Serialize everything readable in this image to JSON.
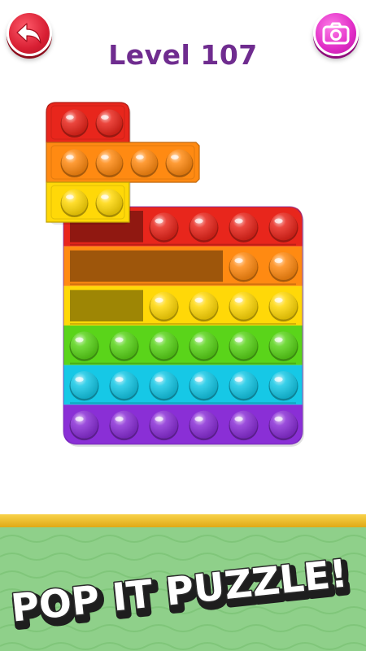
{
  "header": {
    "level_title": "Level 107",
    "back_icon": "back-arrow-icon",
    "camera_icon": "camera-icon"
  },
  "colors": {
    "title": "#6f2c8f",
    "red": "#e8261c",
    "orange": "#ff8a12",
    "yellow": "#ffd808",
    "green": "#5ad41a",
    "cyan": "#16c8e6",
    "purple": "#8a2fd6",
    "banner_bg": "#8fd08a",
    "banner_border": "#e9b31c"
  },
  "board": {
    "rows": [
      {
        "color": "red",
        "popped": 2,
        "unpopped": 4
      },
      {
        "color": "orange",
        "popped": 4,
        "unpopped": 2
      },
      {
        "color": "yellow",
        "popped": 2,
        "unpopped": 4
      },
      {
        "color": "green",
        "popped": 0,
        "unpopped": 6
      },
      {
        "color": "cyan",
        "popped": 0,
        "unpopped": 6
      },
      {
        "color": "purple",
        "popped": 0,
        "unpopped": 6
      }
    ]
  },
  "loose_piece": {
    "rows": [
      {
        "color": "red",
        "bubbles": 2
      },
      {
        "color": "orange",
        "bubbles": 4
      },
      {
        "color": "yellow",
        "bubbles": 2
      }
    ]
  },
  "banner": {
    "text": "POP IT PUZZLE!"
  }
}
